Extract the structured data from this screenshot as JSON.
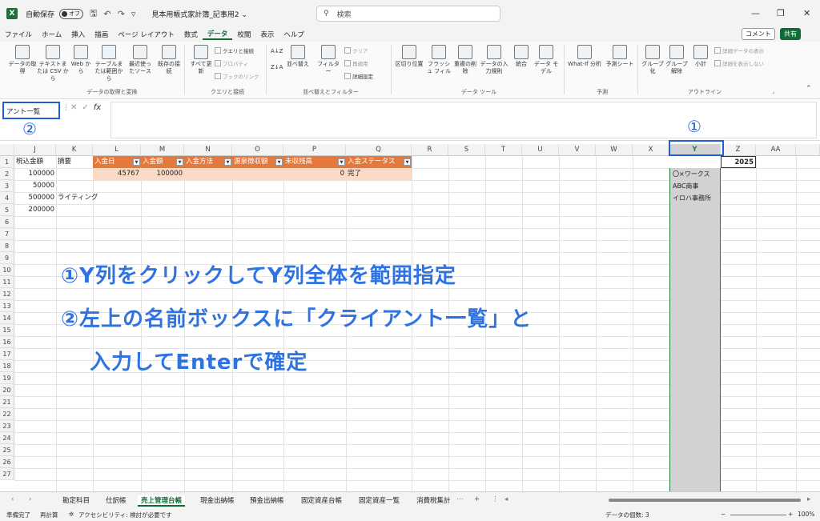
{
  "titlebar": {
    "app_icon": "X",
    "autosave_label": "自動保存",
    "autosave_state": "オフ",
    "doc_title": "見本用帳式家計簿_記事用2",
    "doc_title_caret": "⌄",
    "search_placeholder": "検索",
    "search_icon": "⚲",
    "save_icon": "🖫",
    "undo_icon": "↶",
    "redo_icon": "↷",
    "more_icon": "▿",
    "min_icon": "—",
    "restore_icon": "❐",
    "close_icon": "✕"
  },
  "menu": {
    "items": [
      "ファイル",
      "ホーム",
      "挿入",
      "描画",
      "ページ レイアウト",
      "数式",
      "データ",
      "校閲",
      "表示",
      "ヘルプ"
    ],
    "active": "データ",
    "comment_label": "コメント",
    "share_label": "共有"
  },
  "ribbon": {
    "get_data": "データの取得",
    "from_csv": "テキストまたは CSV から",
    "from_web": "Web から",
    "from_table": "テーブルまたは範囲から",
    "recent": "最近使ったソース",
    "existing": "既存の接続",
    "refresh": "すべて更新",
    "queries": "クエリと接続",
    "properties": "プロパティ",
    "links": "ブックのリンク",
    "sort": "並べ替え",
    "filter": "フィルター",
    "clear": "クリア",
    "reapply": "再適用",
    "advanced": "詳細設定",
    "text_to_cols": "区切り位置",
    "flash_fill": "フラッシュ フィル",
    "remove_dup": "重複の削除",
    "validation": "データの入力規則",
    "consolidate": "統合",
    "data_model": "データ モデル",
    "whatif": "What-If 分析",
    "forecast": "予測シート",
    "group": "グループ化",
    "ungroup": "グループ解除",
    "subtotal": "小計",
    "show_detail": "詳細データの表示",
    "hide_detail": "詳細を表示しない",
    "sort_asc": "A↓Z",
    "sort_desc": "Z↓A",
    "launcher_icon": "⌟",
    "collapse_icon": "⌃",
    "groups": [
      "データの取得と変換",
      "クエリと接続",
      "並べ替えとフィルター",
      "データ ツール",
      "予測",
      "アウトライン"
    ]
  },
  "formula_bar": {
    "name_box_value": "アント一覧",
    "fx_label": "fx",
    "cancel_icon": "✕",
    "confirm_icon": "✓",
    "dots": "⋮",
    "marker_name_box": "②",
    "marker_col_y": "①"
  },
  "columns": [
    "J",
    "K",
    "L",
    "M",
    "N",
    "O",
    "P",
    "Q",
    "R",
    "S",
    "T",
    "U",
    "V",
    "W",
    "X",
    "Y",
    "Z",
    "AA"
  ],
  "rows": [
    "1",
    "2",
    "3",
    "4",
    "5",
    "6",
    "7",
    "8",
    "9",
    "10",
    "11",
    "12",
    "13",
    "14",
    "15",
    "16",
    "17",
    "18",
    "19",
    "20",
    "21",
    "22",
    "23",
    "24",
    "25",
    "26",
    "27"
  ],
  "cells": {
    "J1": "税込金額",
    "K1": "摘要",
    "J2": "100000",
    "J3": "50000",
    "J4": "500000",
    "J5": "200000",
    "K4": "ライティング",
    "L2": "45767",
    "M2": "100000",
    "P2": "0",
    "Q2": "完了",
    "Z1": "2025",
    "Y2": "〇×ワークス",
    "Y3": "ABC商事",
    "Y4": "イロハ事務所"
  },
  "table_headers": [
    "入金日",
    "入金額",
    "入金方法",
    "源泉徴収額",
    "未収残高",
    "入金ステータス"
  ],
  "annotations": {
    "line1": "①Y列をクリックしてY列全体を範囲指定",
    "line2": "②左上の名前ボックスに「クライアント一覧」と",
    "line3": "入力してEnterで確定"
  },
  "sheet_tabs": [
    "勘定科目",
    "仕訳帳",
    "売上管理台帳",
    "現金出納帳",
    "預金出納帳",
    "固定資産台帳",
    "固定資産一覧",
    "消費税集計"
  ],
  "active_sheet": "売上管理台帳",
  "tabbar": {
    "prev_icon": "‹",
    "next_icon": "›",
    "more_icon": "⋯",
    "add_icon": "+",
    "options_icon": "⋮",
    "scroll_left_icon": "◂",
    "scroll_right_icon": "▸"
  },
  "status": {
    "ready": "準備完了",
    "recalc": "再計算",
    "accessibility": "アクセシビリティ: 検討が必要です",
    "accessibility_icon": "✲",
    "count": "データの個数: 3",
    "zoom": "100%",
    "zoom_out": "−",
    "zoom_in": "+"
  },
  "colors": {
    "accent": "#0e6b35",
    "table_header": "#e5793b",
    "annotation": "#2f73e0"
  }
}
